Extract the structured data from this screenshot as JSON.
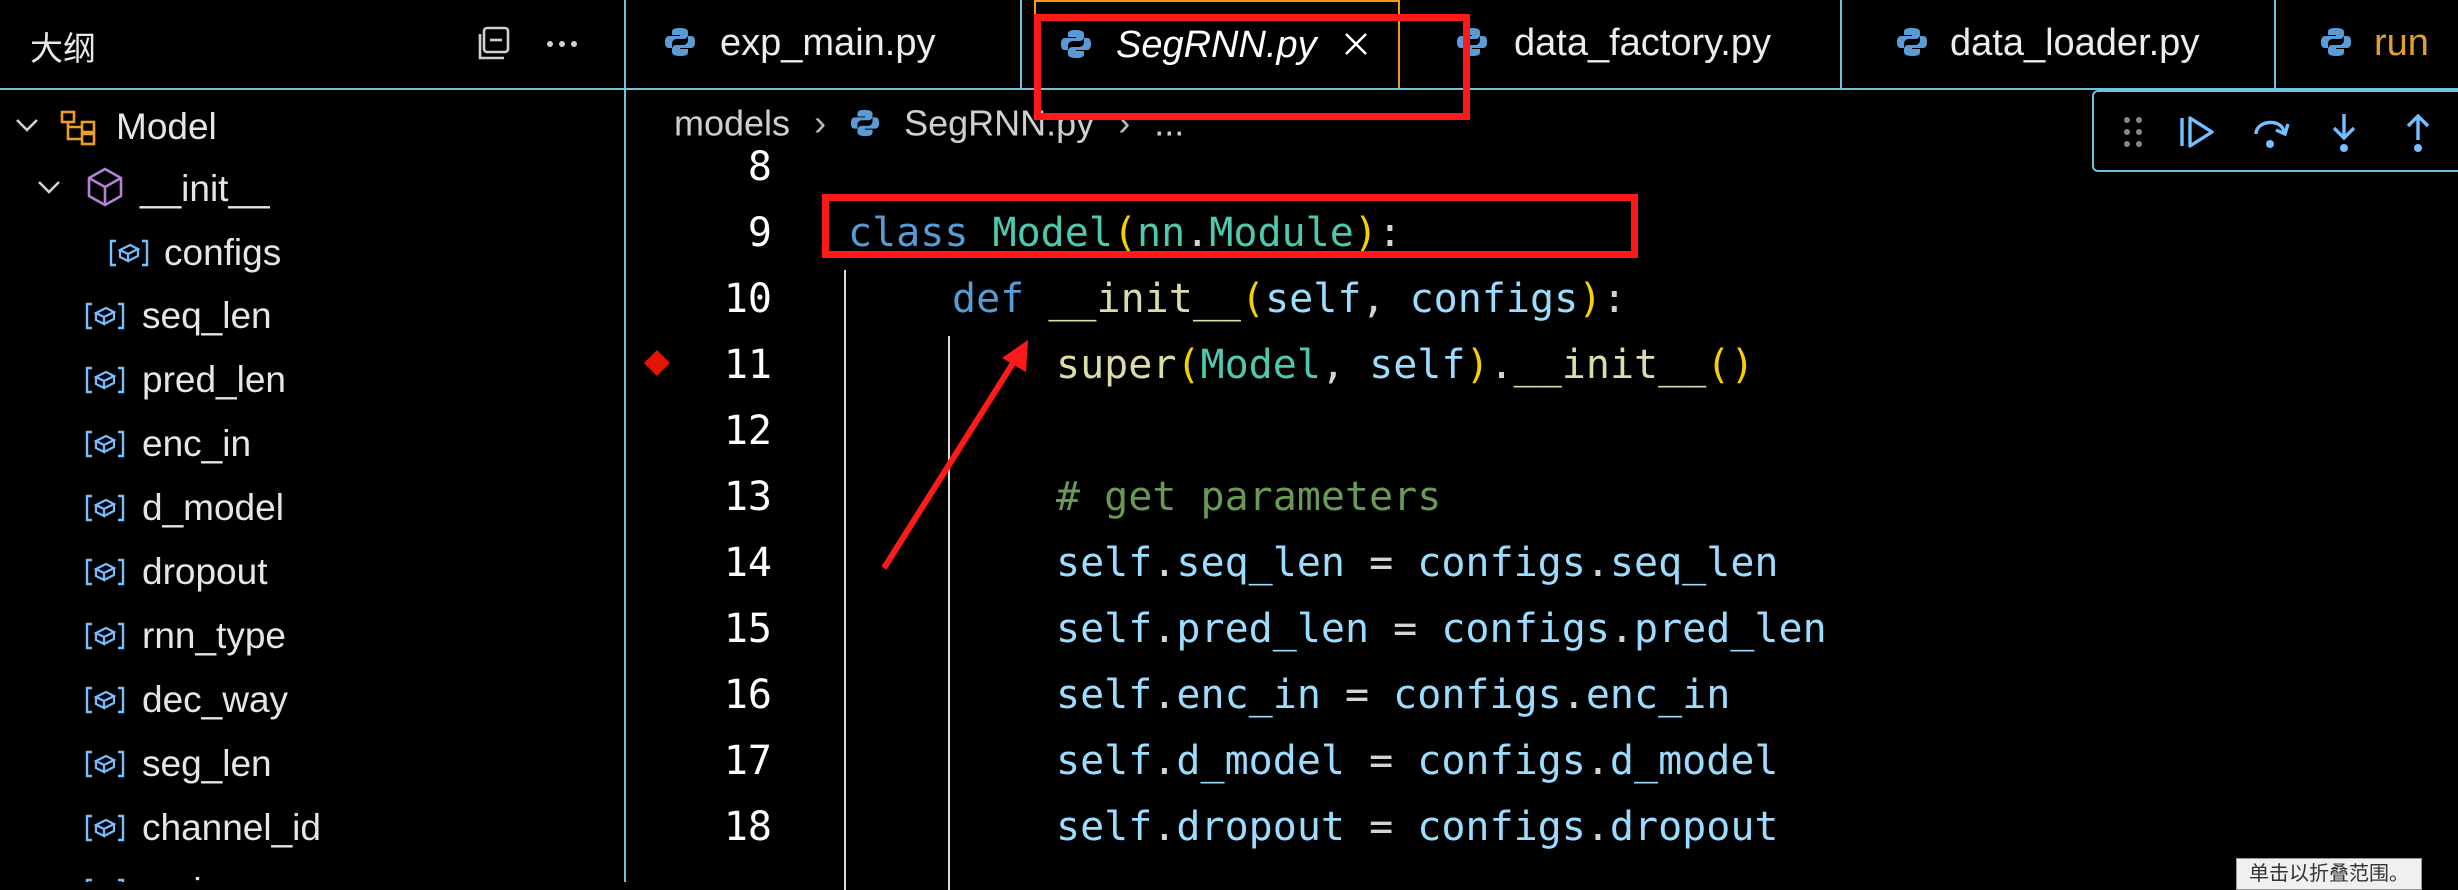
{
  "outline": {
    "title": "大纲",
    "root": {
      "label": "Model",
      "icon": "class-icon"
    },
    "init": {
      "label": "__init__",
      "icon": "method-cube-icon"
    },
    "configs": {
      "label": "configs"
    },
    "items": [
      "seq_len",
      "pred_len",
      "enc_in",
      "d_model",
      "dropout",
      "rnn_type",
      "dec_way",
      "seg_len",
      "channel_id",
      "revin"
    ]
  },
  "tabs": [
    {
      "label": "exp_main.py",
      "active": false
    },
    {
      "label": "SegRNN.py",
      "active": true
    },
    {
      "label": "data_factory.py",
      "active": false
    },
    {
      "label": "data_loader.py",
      "active": false
    },
    {
      "label": "run",
      "active": false
    }
  ],
  "breadcrumb": {
    "folder": "models",
    "file": "SegRNN.py",
    "more": "..."
  },
  "code": {
    "line_numbers": [
      "8",
      "9",
      "10",
      "11",
      "12",
      "13",
      "14",
      "15",
      "16",
      "17",
      "18"
    ],
    "lines": {
      "l9": {
        "kw": "class",
        "name": "Model",
        "base1": "nn",
        "base2": "Module"
      },
      "l10": {
        "kw": "def",
        "fn": "__init__",
        "a1": "self",
        "a2": "configs"
      },
      "l11": {
        "fn": "super",
        "a1": "Model",
        "a2": "self",
        "m": "__init__"
      },
      "l13": {
        "comment": "# get parameters"
      },
      "assign": [
        {
          "attr": "seq_len",
          "src": "seq_len"
        },
        {
          "attr": "pred_len",
          "src": "pred_len"
        },
        {
          "attr": "enc_in",
          "src": "enc_in"
        },
        {
          "attr": "d_model",
          "src": "d_model"
        },
        {
          "attr": "dropout",
          "src": "dropout"
        }
      ],
      "self_kw": "self",
      "configs_kw": "configs"
    }
  },
  "tooltip": "单击以折叠范围。",
  "colors": {
    "accent_border": "#6fc3df",
    "active_tab_border": "#f39c12",
    "annotation_red": "#ff1a1a",
    "breakpoint": "#e51400"
  }
}
